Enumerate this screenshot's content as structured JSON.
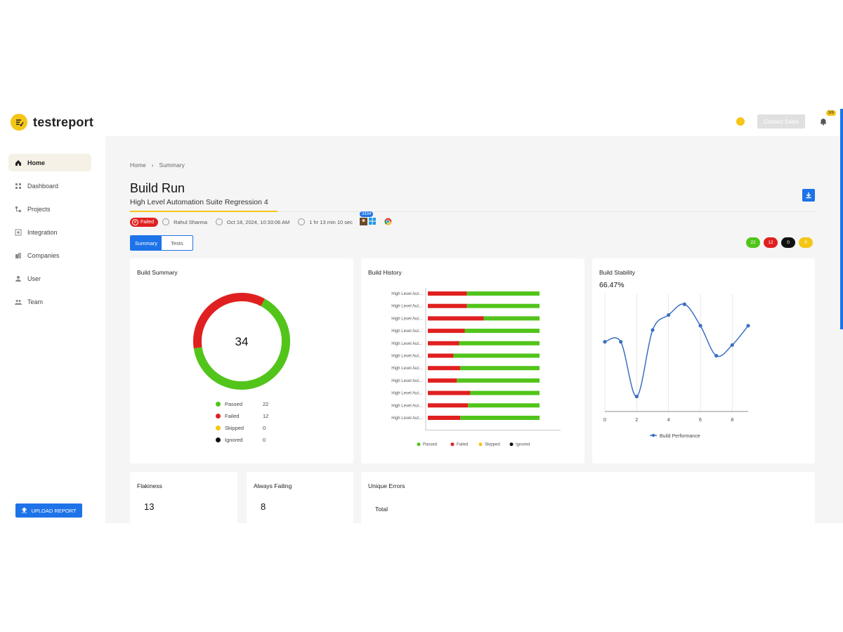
{
  "app": {
    "logo_text": "testreport",
    "contact_label": "Contact Sales",
    "notification_count": "3/6"
  },
  "sidebar": {
    "items": [
      {
        "label": "Home",
        "icon": "home-icon"
      },
      {
        "label": "Dashboard",
        "icon": "dashboard-icon"
      },
      {
        "label": "Projects",
        "icon": "projects-icon"
      },
      {
        "label": "Integration",
        "icon": "integration-icon"
      },
      {
        "label": "Companies",
        "icon": "companies-icon"
      },
      {
        "label": "User",
        "icon": "user-icon"
      },
      {
        "label": "Team",
        "icon": "team-icon"
      }
    ],
    "upload_label": "UPLOAD REPORT"
  },
  "breadcrumb": [
    "Home",
    "Summary"
  ],
  "page": {
    "title": "Build Run",
    "subtitle": "High Level Automation Suite Regression 4"
  },
  "meta": {
    "status": "Failed",
    "user": "Rahul Sharma",
    "date": "Oct 18, 2024, 10:33:06 AM",
    "duration": "1 hr 13 min 10 sec",
    "os_badge": "3334"
  },
  "tabs": [
    "Summary",
    "Tests"
  ],
  "status_counts": [
    {
      "value": "22",
      "color": "#52c41a"
    },
    {
      "value": "12",
      "color": "#e02020"
    },
    {
      "value": "0",
      "color": "#111111"
    },
    {
      "value": "0",
      "color": "#f5c518"
    }
  ],
  "cards": {
    "build_summary": "Build Summary",
    "build_history": "Build History",
    "build_stability": "Build Stability",
    "stability_value": "66.47%",
    "flakiness_title": "Flakiness",
    "flakiness_value": "13",
    "always_failing_title": "Always Failing",
    "always_failing_value": "8",
    "unique_errors_title": "Unique Errors",
    "unique_errors_total_label": "Total"
  },
  "chart_data": [
    {
      "type": "pie",
      "title": "Build Summary",
      "center_label": "34",
      "categories": [
        "Passed",
        "Failed",
        "Skipped",
        "Ignored"
      ],
      "values": [
        22,
        12,
        0,
        0
      ],
      "colors": [
        "#52c41a",
        "#e02020",
        "#f5c518",
        "#111111"
      ]
    },
    {
      "type": "bar",
      "title": "Build History",
      "orientation": "horizontal",
      "stacked": true,
      "categories": [
        "High Level Aut...",
        "High Level Aut...",
        "High Level Aut...",
        "High Level Aut...",
        "High Level Aut...",
        "High Level Aut...",
        "High Level Aut...",
        "High Level Aut...",
        "High Level Aut...",
        "High Level Aut...",
        "High Level Aut..."
      ],
      "series": [
        {
          "name": "Passed",
          "color": "#52c41a",
          "values": [
            65,
            65,
            50,
            67,
            72,
            77,
            71,
            74,
            62,
            64,
            71
          ]
        },
        {
          "name": "Failed",
          "color": "#e02020",
          "values": [
            35,
            35,
            50,
            33,
            28,
            23,
            29,
            26,
            38,
            36,
            29
          ]
        },
        {
          "name": "Skipped",
          "color": "#f5c518",
          "values": [
            0,
            0,
            0,
            0,
            0,
            0,
            0,
            0,
            0,
            0,
            0
          ]
        },
        {
          "name": "Ignored",
          "color": "#111111",
          "values": [
            0,
            0,
            0,
            0,
            0,
            0,
            0,
            0,
            0,
            0,
            0
          ]
        }
      ],
      "xlim": [
        0,
        100
      ]
    },
    {
      "type": "line",
      "title": "Build Stability",
      "x": [
        0,
        1,
        2,
        3,
        4,
        5,
        6,
        7,
        8,
        9
      ],
      "x_ticks": [
        0,
        2,
        4,
        6,
        8
      ],
      "series": [
        {
          "name": "Build Performance",
          "color": "#3b6fc4",
          "values": [
            65,
            65,
            14,
            76,
            90,
            100,
            80,
            52,
            62,
            80
          ]
        }
      ],
      "ylim": [
        0,
        110
      ],
      "grid": "vertical",
      "legend": "bottom"
    }
  ]
}
